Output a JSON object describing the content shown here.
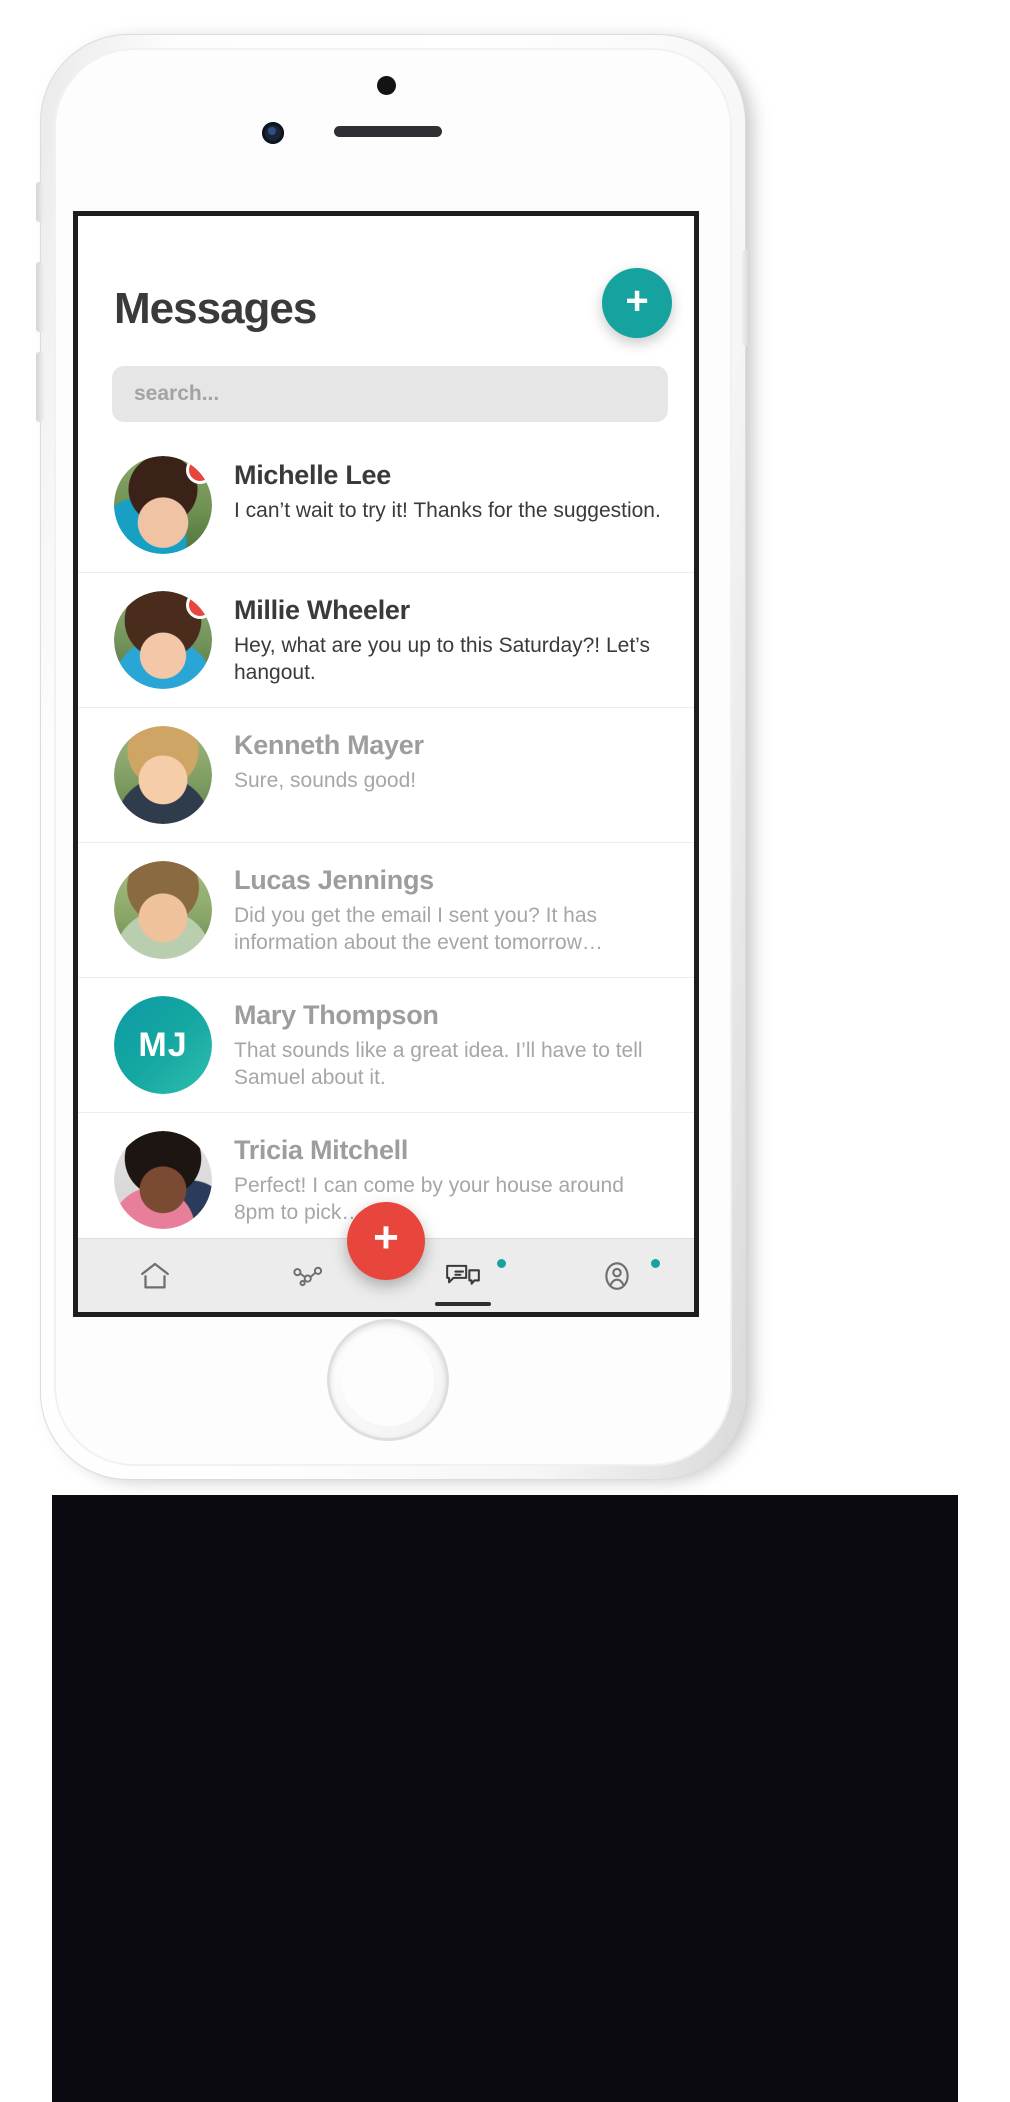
{
  "app": {
    "title": "Messages",
    "accent_teal": "#16a3a0",
    "accent_red": "#e8463c",
    "compose_label": "+",
    "fab_label": "+"
  },
  "search": {
    "placeholder": "search...",
    "value": ""
  },
  "conversations": [
    {
      "name": "Michelle Lee",
      "preview": "I can’t wait to try it! Thanks for the suggestion.",
      "unread": true,
      "avatar_type": "photo"
    },
    {
      "name": "Millie Wheeler",
      "preview": "Hey, what are you up to this Saturday?! Let’s hangout.",
      "unread": true,
      "avatar_type": "photo"
    },
    {
      "name": "Kenneth Mayer",
      "preview": "Sure, sounds good!",
      "unread": false,
      "avatar_type": "photo"
    },
    {
      "name": "Lucas Jennings",
      "preview": "Did you get the email I sent you? It has information about the event tomorrow…",
      "unread": false,
      "avatar_type": "photo"
    },
    {
      "name": "Mary Thompson",
      "preview": "That sounds like a great idea. I’ll have to tell Samuel about it.",
      "unread": false,
      "avatar_type": "initials",
      "initials": "MJ"
    },
    {
      "name": "Tricia Mitchell",
      "preview": "Perfect! I can come by your house around 8pm to pick…",
      "unread": false,
      "avatar_type": "photo"
    }
  ],
  "tabbar": {
    "items": [
      {
        "icon": "home-icon",
        "active": false,
        "badge": false
      },
      {
        "icon": "activity-network-icon",
        "active": false,
        "badge": false
      },
      {
        "icon": "messages-icon",
        "active": true,
        "badge": true
      },
      {
        "icon": "profile-icon",
        "active": false,
        "badge": true
      }
    ]
  }
}
